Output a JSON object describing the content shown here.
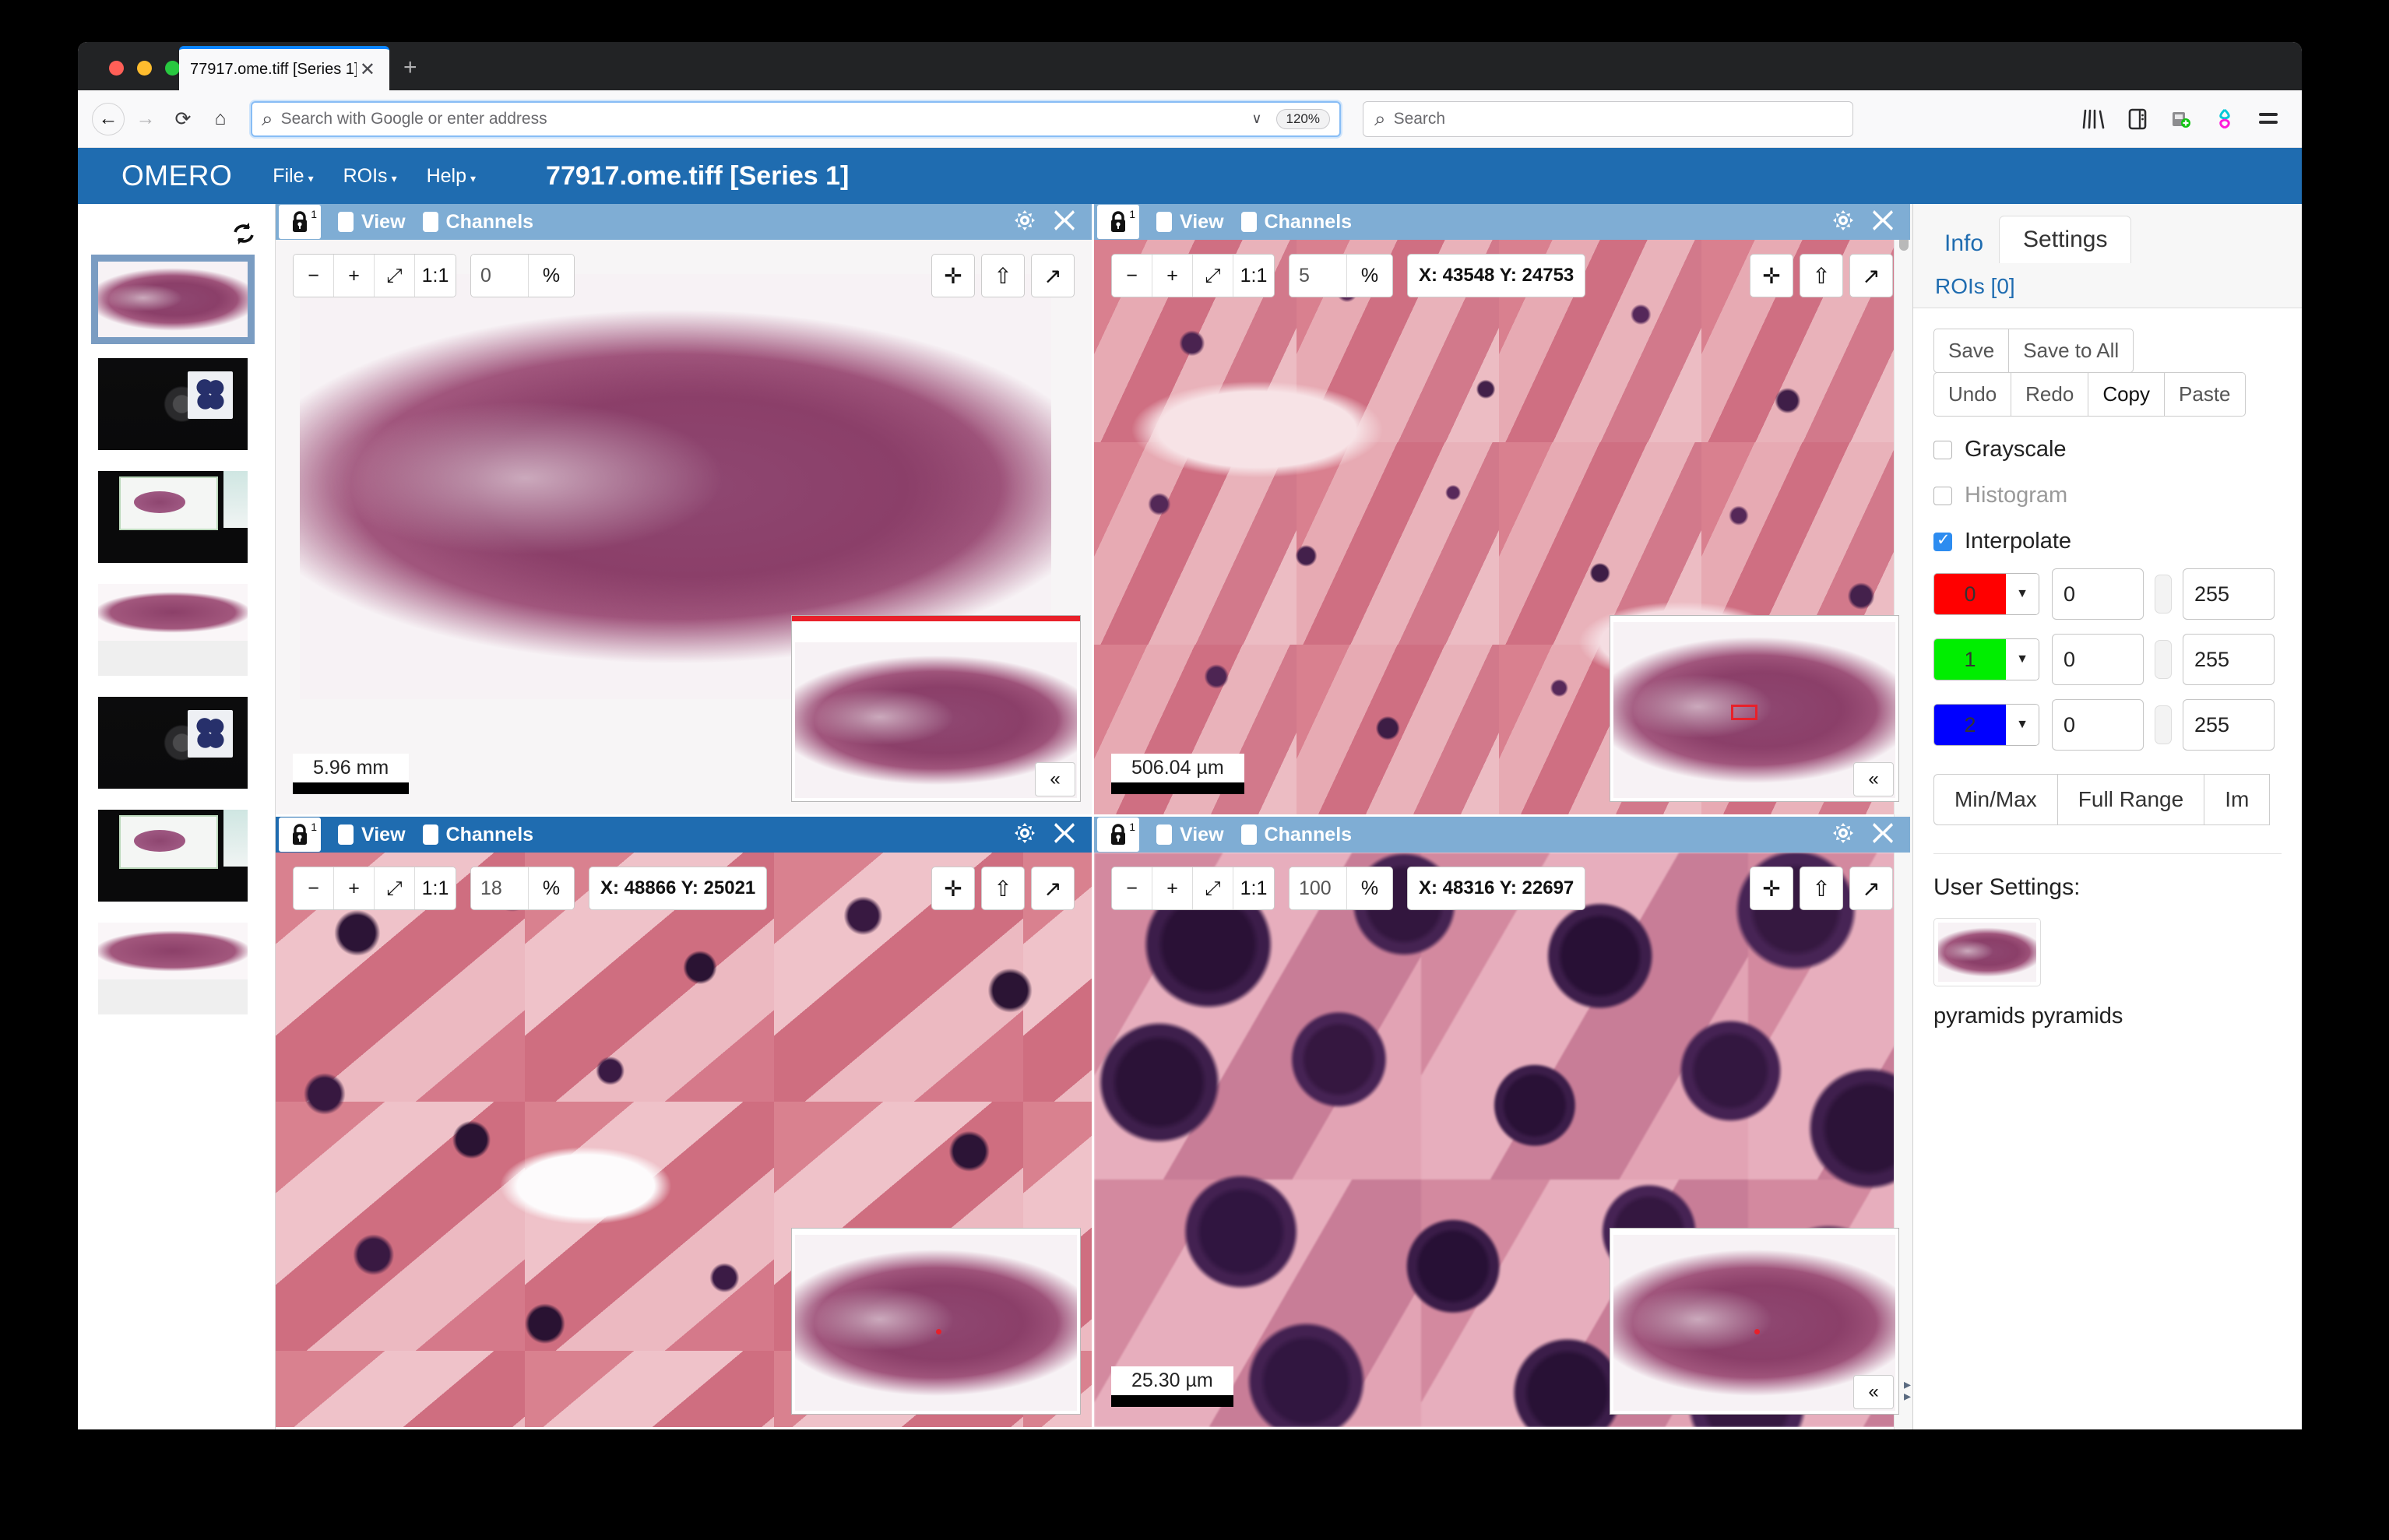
{
  "browser": {
    "tab_title": "77917.ome.tiff [Series 1]",
    "close_icon": "✕",
    "new_tab_icon": "+",
    "back_icon": "←",
    "forward_icon": "→",
    "reload_icon": "⟳",
    "home_icon": "⌂",
    "url_placeholder": "Search with Google or enter address",
    "url_value": "",
    "zoom_level": "120%",
    "chevron_icon": "∨",
    "search_placeholder": "Search",
    "search_value": "",
    "search_icon": "⌕",
    "library_icon": "library-icon",
    "sidebar_icon": "sidebar-icon",
    "save_to_pocket_icon": "pocket-icon",
    "account_icon": "account-icon",
    "menu_icon": "☰"
  },
  "omero": {
    "brand": "OMERO",
    "menu": [
      {
        "label": "File",
        "caret": "▾"
      },
      {
        "label": "ROIs",
        "caret": "▾"
      },
      {
        "label": "Help",
        "caret": "▾"
      }
    ],
    "document_title": "77917.ome.tiff [Series 1]"
  },
  "thumbstrip": {
    "refresh_icon": "⟳",
    "items": [
      {
        "name": "thumb-tissue-selected",
        "kind": "tissue",
        "selected": true
      },
      {
        "name": "thumb-dark-slide-1",
        "kind": "dark",
        "selected": false
      },
      {
        "name": "thumb-slide-card-1",
        "kind": "card",
        "selected": false
      },
      {
        "name": "thumb-tissue-2",
        "kind": "tissue2",
        "selected": false
      },
      {
        "name": "thumb-dark-slide-2",
        "kind": "dark",
        "selected": false
      },
      {
        "name": "thumb-slide-card-2",
        "kind": "card",
        "selected": false
      },
      {
        "name": "thumb-tissue-3",
        "kind": "tissue2",
        "selected": false
      }
    ]
  },
  "viewers": [
    {
      "id": "viewer-1",
      "titlebar_style": "light",
      "lock_label": "1",
      "view_label": "View",
      "channels_label": "Channels",
      "gear_icon": "✿",
      "close_icon": "✕",
      "zoom_out": "−",
      "zoom_in": "+",
      "fit": "⤢",
      "one_to_one": "1:1",
      "zoom_value": "0",
      "percent": "%",
      "coords": "",
      "show_coords": false,
      "crosshair_icon": "✛",
      "up_icon": "⇧",
      "expand_icon": "↗",
      "scalebar": "5.96 mm",
      "collapse_icon": "«",
      "texture": "hist-a",
      "minimap_marker": "none"
    },
    {
      "id": "viewer-2",
      "titlebar_style": "light",
      "lock_label": "1",
      "view_label": "View",
      "channels_label": "Channels",
      "gear_icon": "✿",
      "close_icon": "✕",
      "zoom_out": "−",
      "zoom_in": "+",
      "fit": "⤢",
      "one_to_one": "1:1",
      "zoom_value": "5",
      "percent": "%",
      "coords": "X: 43548 Y: 24753",
      "show_coords": true,
      "crosshair_icon": "✛",
      "up_icon": "⇧",
      "expand_icon": "↗",
      "scalebar": "506.04 µm",
      "collapse_icon": "«",
      "texture": "hist-b",
      "minimap_marker": "roi"
    },
    {
      "id": "viewer-3",
      "titlebar_style": "dark",
      "lock_label": "1",
      "view_label": "View",
      "channels_label": "Channels",
      "gear_icon": "✿",
      "close_icon": "✕",
      "zoom_out": "−",
      "zoom_in": "+",
      "fit": "⤢",
      "one_to_one": "1:1",
      "zoom_value": "18",
      "percent": "%",
      "coords": "X: 48866 Y: 25021",
      "show_coords": true,
      "crosshair_icon": "✛",
      "up_icon": "⇧",
      "expand_icon": "↗",
      "scalebar": "",
      "collapse_icon": "«",
      "texture": "hist-b",
      "minimap_marker": "dot"
    },
    {
      "id": "viewer-4",
      "titlebar_style": "light",
      "lock_label": "1",
      "view_label": "View",
      "channels_label": "Channels",
      "gear_icon": "✿",
      "close_icon": "✕",
      "zoom_out": "−",
      "zoom_in": "+",
      "fit": "⤢",
      "one_to_one": "1:1",
      "zoom_value": "100",
      "percent": "%",
      "coords": "X: 48316 Y: 22697",
      "show_coords": true,
      "crosshair_icon": "✛",
      "up_icon": "⇧",
      "expand_icon": "↗",
      "scalebar": "25.30 µm",
      "collapse_icon": "«",
      "texture": "hist-c",
      "minimap_marker": "dot"
    }
  ],
  "rightpanel": {
    "tab_info": "Info",
    "tab_settings": "Settings",
    "rois_link": "ROIs [0]",
    "save": "Save",
    "save_to_all": "Save to All",
    "undo": "Undo",
    "redo": "Redo",
    "copy": "Copy",
    "paste": "Paste",
    "grayscale": "Grayscale",
    "histogram": "Histogram",
    "interpolate": "Interpolate",
    "channels": [
      {
        "index": "0",
        "color": "#ff0000",
        "min": "0",
        "max": "255",
        "caret": "▼"
      },
      {
        "index": "1",
        "color": "#00ee00",
        "min": "0",
        "max": "255",
        "caret": "▼"
      },
      {
        "index": "2",
        "color": "#0000ff",
        "min": "0",
        "max": "255",
        "caret": "▼"
      }
    ],
    "min_max": "Min/Max",
    "full_range": "Full Range",
    "imported": "Im",
    "user_settings_title": "User Settings:",
    "user_settings_name": "pyramids pyramids"
  },
  "colors": {
    "brand_blue": "#1f6cb0",
    "title_light": "#7fadd4",
    "accent_link": "#1f6cb0",
    "scalebar": "#000000",
    "roi_red": "#e8202a"
  }
}
